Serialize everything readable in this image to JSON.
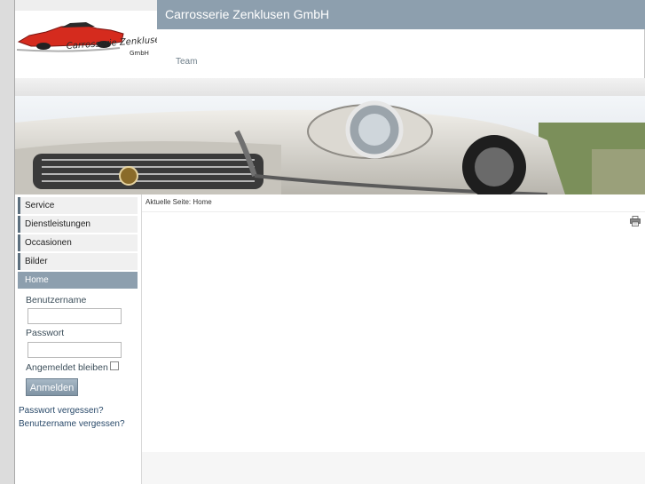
{
  "header": {
    "site_title": "Carrosserie Zenklusen GmbH",
    "logo": {
      "line1": "Carrosserie Zenklusen",
      "line2": "GmbH"
    },
    "team_link": "Team"
  },
  "sidebar": {
    "items": [
      {
        "label": "Service"
      },
      {
        "label": "Dienstleistungen"
      },
      {
        "label": "Occasionen"
      },
      {
        "label": "Bilder"
      },
      {
        "label": "Home"
      }
    ],
    "login": {
      "username_label": "Benutzername",
      "password_label": "Passwort",
      "remember_label": "Angemeldet bleiben",
      "login_button": "Anmelden",
      "forgot_password": "Passwort vergessen?",
      "forgot_username": "Benutzername vergessen?"
    }
  },
  "content": {
    "breadcrumb": "Aktuelle Seite: Home"
  },
  "colors": {
    "accent": "#8d9fae",
    "nav_border": "#5c6f7e",
    "logo_red": "#d52b1e"
  }
}
